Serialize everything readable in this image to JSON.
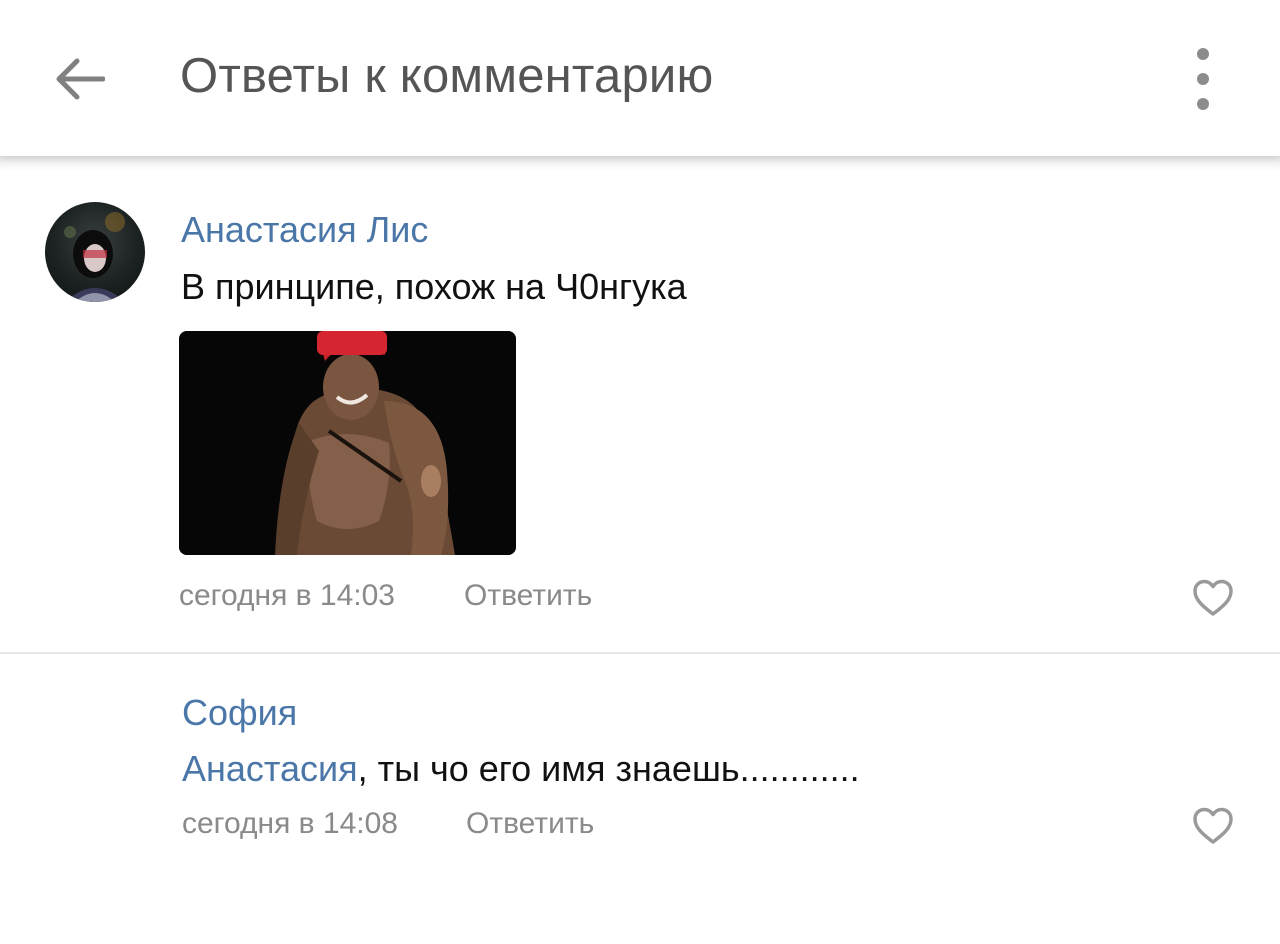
{
  "header": {
    "title": "Ответы к комментарию",
    "back_icon": "arrow-left-icon",
    "menu_icon": "more-vertical-icon"
  },
  "comments": [
    {
      "author": "Анастасия Лис",
      "text": "В принципе, похож на Ч0нгука",
      "time": "сегодня в 14:03",
      "reply_label": "Ответить",
      "has_photo": true,
      "like_icon": "heart-outline-icon"
    },
    {
      "author": "София",
      "mention": "Анастасия",
      "text": ", ты чо его имя знаешь............",
      "time": "сегодня в 14:08",
      "reply_label": "Ответить",
      "like_icon": "heart-outline-icon"
    }
  ],
  "colors": {
    "link": "#4a76a8",
    "meta": "#8a8a8a",
    "title": "#555555",
    "text": "#111111"
  }
}
